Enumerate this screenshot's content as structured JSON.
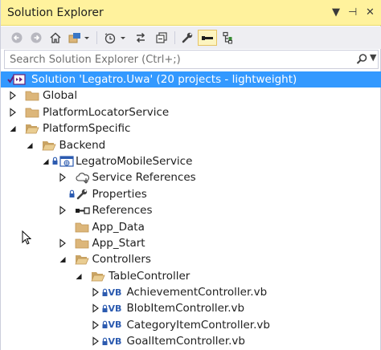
{
  "window": {
    "title": "Solution Explorer",
    "dropdown_glyph": "▼",
    "pin_glyph": "⊣",
    "close_glyph": "✕"
  },
  "toolbar": {
    "icons": [
      "back-arrow-icon",
      "forward-arrow-icon",
      "home-icon",
      "switch-views-icon",
      "history-icon",
      "sync-icon",
      "collapse-all-icon",
      "properties-wrench-icon",
      "preview-selected-icon",
      "show-all-files-icon"
    ]
  },
  "search": {
    "placeholder": "Search Solution Explorer (Ctrl+;)",
    "value": ""
  },
  "tree": [
    {
      "label": "Solution 'Legatro.Uwa' (20 projects - lightweight)",
      "icon": "solution-icon",
      "expander": "none",
      "level": 0,
      "selected": true
    },
    {
      "label": "Global",
      "icon": "folder-icon",
      "expander": "collapsed",
      "level": 0
    },
    {
      "label": "PlatformLocatorService",
      "icon": "folder-icon",
      "expander": "collapsed",
      "level": 0
    },
    {
      "label": "PlatformSpecific",
      "icon": "folder-open-icon",
      "expander": "expanded",
      "level": 0
    },
    {
      "label": "Backend",
      "icon": "folder-open-icon",
      "expander": "expanded",
      "level": 1
    },
    {
      "label": "LegatroMobileService",
      "icon": "web-project-icon",
      "expander": "expanded",
      "level": 2,
      "lock": true
    },
    {
      "label": "Service References",
      "icon": "service-references-icon",
      "expander": "collapsed",
      "level": 3
    },
    {
      "label": "Properties",
      "icon": "wrench-icon",
      "expander": "none",
      "level": 3,
      "lock": true
    },
    {
      "label": "References",
      "icon": "references-icon",
      "expander": "collapsed",
      "level": 3
    },
    {
      "label": "App_Data",
      "icon": "folder-icon",
      "expander": "none",
      "level": 3
    },
    {
      "label": "App_Start",
      "icon": "folder-icon",
      "expander": "collapsed",
      "level": 3
    },
    {
      "label": "Controllers",
      "icon": "folder-open-icon",
      "expander": "expanded",
      "level": 3
    },
    {
      "label": "TableController",
      "icon": "folder-open-icon",
      "expander": "expanded",
      "level": 4
    },
    {
      "label": "AchievementController.vb",
      "icon": "vb-file-icon",
      "expander": "collapsed",
      "level": 5,
      "lock": true,
      "badge": "VB"
    },
    {
      "label": "BlobItemController.vb",
      "icon": "vb-file-icon",
      "expander": "collapsed",
      "level": 5,
      "lock": true,
      "badge": "VB"
    },
    {
      "label": "CategoryItemController.vb",
      "icon": "vb-file-icon",
      "expander": "collapsed",
      "level": 5,
      "lock": true,
      "badge": "VB"
    },
    {
      "label": "GoalItemController.vb",
      "icon": "vb-file-icon",
      "expander": "collapsed",
      "level": 5,
      "lock": true,
      "badge": "VB"
    }
  ],
  "colors": {
    "title_bg": "#fff29d",
    "toolbar_bg": "#eeeef2",
    "selection": "#3399ff",
    "folder": "#dcb67a",
    "vb": "#2c5bb0"
  }
}
